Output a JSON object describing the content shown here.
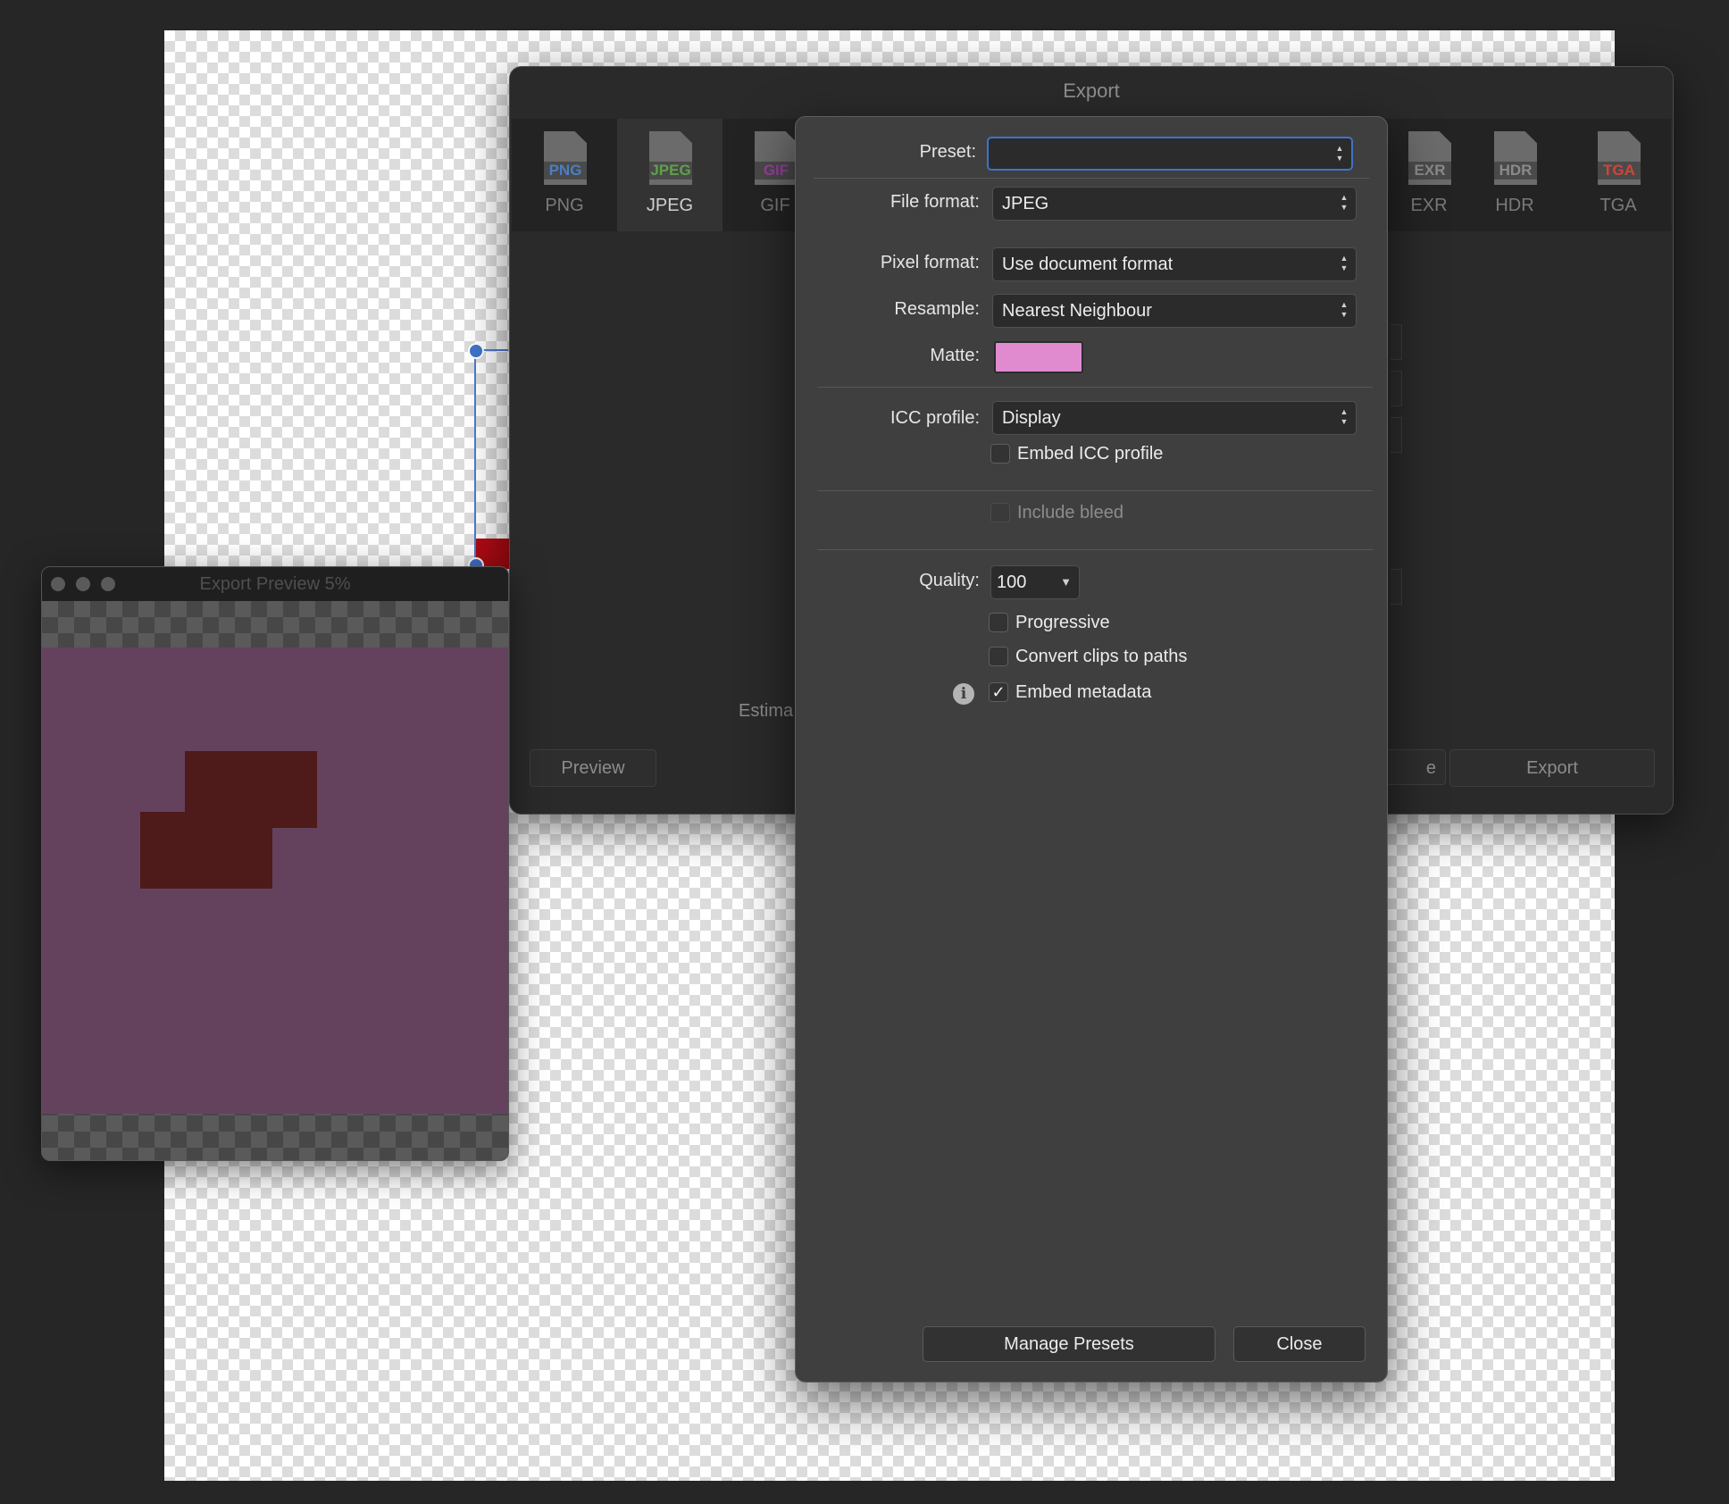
{
  "export_dialog": {
    "title": "Export",
    "formats": [
      {
        "name": "PNG",
        "badge": "PNG",
        "badge_color": "#4a7fc1"
      },
      {
        "name": "JPEG",
        "badge": "JPEG",
        "badge_color": "#5fa04a"
      },
      {
        "name": "GIF",
        "badge": "GIF",
        "badge_color": "#9b3fa0"
      },
      {
        "name": "EXR",
        "badge": "EXR",
        "badge_color": "#8a8a8a"
      },
      {
        "name": "HDR",
        "badge": "HDR",
        "badge_color": "#8a8a8a"
      },
      {
        "name": "TGA",
        "badge": "TGA",
        "badge_color": "#d0453a"
      }
    ],
    "selected_format": "JPEG",
    "estimate_label": "Estima",
    "preview_button": "Preview",
    "save_button_partial": "e",
    "export_button": "Export"
  },
  "preview_window": {
    "title": "Export Preview 5%",
    "image_color": "#64425e",
    "shape_color": "#4e1a1a"
  },
  "settings": {
    "preset": {
      "label": "Preset:",
      "value": ""
    },
    "file_format": {
      "label": "File format:",
      "value": "JPEG"
    },
    "pixel_format": {
      "label": "Pixel format:",
      "value": "Use document format"
    },
    "resample": {
      "label": "Resample:",
      "value": "Nearest Neighbour"
    },
    "matte": {
      "label": "Matte:",
      "color": "#e08ad0"
    },
    "icc_profile": {
      "label": "ICC profile:",
      "value": "Display"
    },
    "embed_icc": {
      "label": "Embed ICC profile",
      "checked": false
    },
    "include_bleed": {
      "label": "Include bleed",
      "checked": false,
      "enabled": false
    },
    "quality": {
      "label": "Quality:",
      "value": "100"
    },
    "progressive": {
      "label": "Progressive",
      "checked": false
    },
    "convert_clips": {
      "label": "Convert clips to paths",
      "checked": false
    },
    "embed_metadata": {
      "label": "Embed metadata",
      "checked": true
    },
    "manage_presets": "Manage Presets",
    "close": "Close"
  },
  "accent_color": "#3f73c9",
  "selection_shape_color": "#b10b14"
}
